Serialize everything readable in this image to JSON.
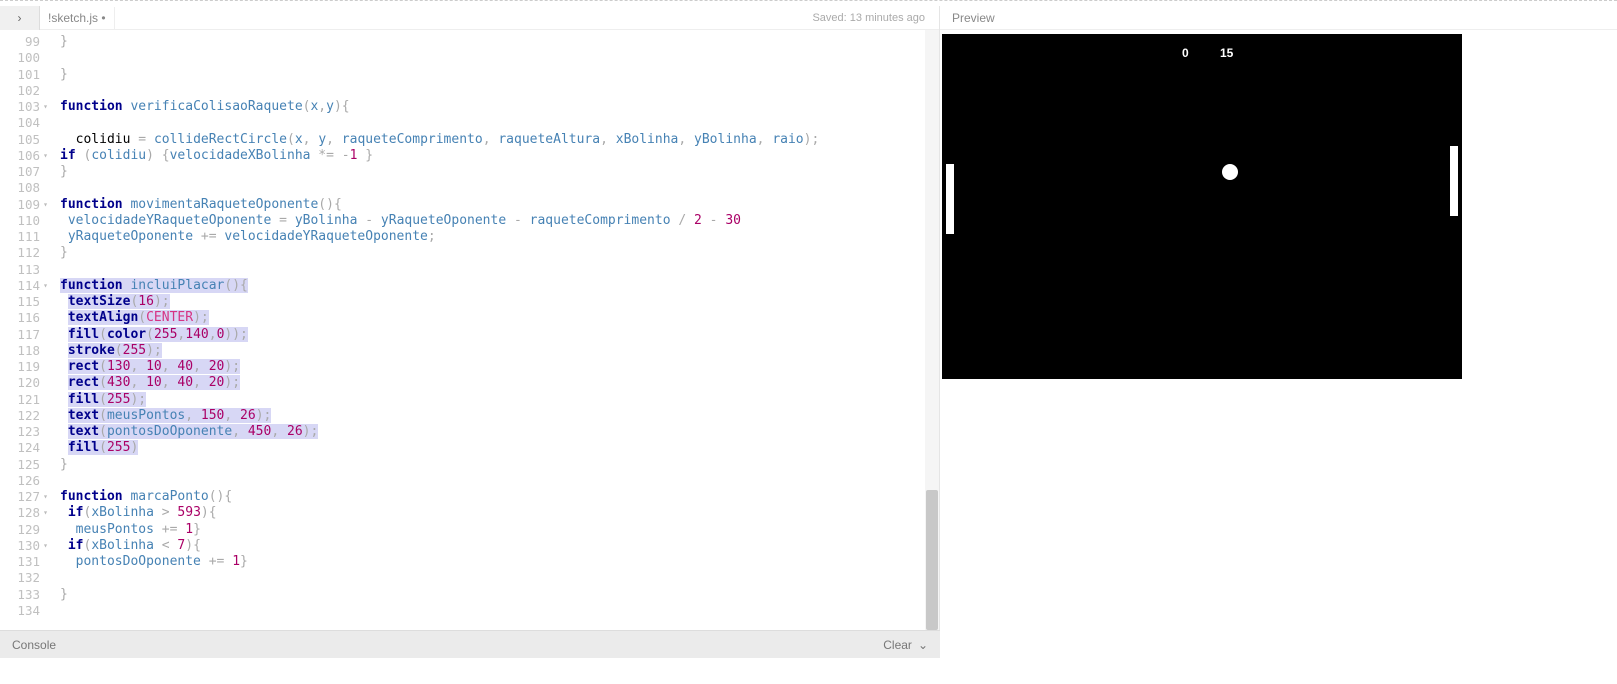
{
  "tab": {
    "toggle_icon": "›",
    "filename": "!sketch.js",
    "dirty": "•"
  },
  "saved": "Saved: 13 minutes ago",
  "preview_label": "Preview",
  "console": {
    "label": "Console",
    "clear": "Clear",
    "chevron": "⌄"
  },
  "lines": [
    {
      "n": 99,
      "h": [
        {
          "t": "}",
          "c": "pr"
        }
      ]
    },
    {
      "n": 100,
      "h": []
    },
    {
      "n": 101,
      "h": [
        {
          "t": "}",
          "c": "pr"
        }
      ]
    },
    {
      "n": 102,
      "h": []
    },
    {
      "n": 103,
      "fold": 1,
      "h": [
        {
          "t": "function ",
          "c": "kw"
        },
        {
          "t": "verificaColisaoRaquete",
          "c": "fn"
        },
        {
          "t": "(",
          "c": "pr"
        },
        {
          "t": "x",
          "c": "id"
        },
        {
          "t": ",",
          "c": "pr"
        },
        {
          "t": "y",
          "c": "id"
        },
        {
          "t": "){",
          "c": "pr"
        }
      ]
    },
    {
      "n": 104,
      "h": []
    },
    {
      "n": 105,
      "h": [
        {
          "t": "  colidiu ",
          "c": ""
        },
        {
          "t": "= ",
          "c": "pr"
        },
        {
          "t": "collideRectCircle",
          "c": "fn"
        },
        {
          "t": "(",
          "c": "pr"
        },
        {
          "t": "x",
          "c": "id"
        },
        {
          "t": ", ",
          "c": "pr"
        },
        {
          "t": "y",
          "c": "id"
        },
        {
          "t": ", ",
          "c": "pr"
        },
        {
          "t": "raqueteComprimento",
          "c": "id"
        },
        {
          "t": ", ",
          "c": "pr"
        },
        {
          "t": "raqueteAltura",
          "c": "id"
        },
        {
          "t": ", ",
          "c": "pr"
        },
        {
          "t": "xBolinha",
          "c": "id"
        },
        {
          "t": ", ",
          "c": "pr"
        },
        {
          "t": "yBolinha",
          "c": "id"
        },
        {
          "t": ", ",
          "c": "pr"
        },
        {
          "t": "raio",
          "c": "id"
        },
        {
          "t": ");",
          "c": "pr"
        }
      ]
    },
    {
      "n": 106,
      "fold": 1,
      "h": [
        {
          "t": "if ",
          "c": "kw"
        },
        {
          "t": "(",
          "c": "pr"
        },
        {
          "t": "colidiu",
          "c": "id"
        },
        {
          "t": ") {",
          "c": "pr"
        },
        {
          "t": "velocidadeXBolinha",
          "c": "id"
        },
        {
          "t": " *= -",
          "c": "pr"
        },
        {
          "t": "1",
          "c": "nm"
        },
        {
          "t": " }",
          "c": "pr"
        }
      ]
    },
    {
      "n": 107,
      "h": [
        {
          "t": "}",
          "c": "pr"
        }
      ]
    },
    {
      "n": 108,
      "h": []
    },
    {
      "n": 109,
      "fold": 1,
      "h": [
        {
          "t": "function ",
          "c": "kw"
        },
        {
          "t": "movimentaRaqueteOponente",
          "c": "fn"
        },
        {
          "t": "(){",
          "c": "pr"
        }
      ]
    },
    {
      "n": 110,
      "h": [
        {
          "t": " velocidadeYRaqueteOponente ",
          "c": "id"
        },
        {
          "t": "= ",
          "c": "pr"
        },
        {
          "t": "yBolinha",
          "c": "id"
        },
        {
          "t": " - ",
          "c": "pr"
        },
        {
          "t": "yRaqueteOponente",
          "c": "id"
        },
        {
          "t": " - ",
          "c": "pr"
        },
        {
          "t": "raqueteComprimento",
          "c": "id"
        },
        {
          "t": " / ",
          "c": "pr"
        },
        {
          "t": "2",
          "c": "nm"
        },
        {
          "t": " - ",
          "c": "pr"
        },
        {
          "t": "30",
          "c": "nm"
        }
      ]
    },
    {
      "n": 111,
      "h": [
        {
          "t": " yRaqueteOponente ",
          "c": "id"
        },
        {
          "t": "+= ",
          "c": "pr"
        },
        {
          "t": "velocidadeYRaqueteOponente",
          "c": "id"
        },
        {
          "t": ";",
          "c": "pr"
        }
      ]
    },
    {
      "n": 112,
      "h": [
        {
          "t": "}",
          "c": "pr"
        }
      ]
    },
    {
      "n": 113,
      "h": []
    },
    {
      "n": 114,
      "fold": 1,
      "h": [
        {
          "t": "function ",
          "c": "kw",
          "s": 1
        },
        {
          "t": "incluiPlacar",
          "c": "fn",
          "s": 1
        },
        {
          "t": "(){",
          "c": "pr",
          "s": 1
        }
      ]
    },
    {
      "n": 115,
      "h": [
        {
          "t": " ",
          "c": ""
        },
        {
          "t": "textSize",
          "c": "kw",
          "s": 1
        },
        {
          "t": "(",
          "c": "pr",
          "s": 1
        },
        {
          "t": "16",
          "c": "nm",
          "s": 1
        },
        {
          "t": ");",
          "c": "pr",
          "s": 1
        }
      ]
    },
    {
      "n": 116,
      "h": [
        {
          "t": " ",
          "c": ""
        },
        {
          "t": "textAlign",
          "c": "kw",
          "s": 1
        },
        {
          "t": "(",
          "c": "pr",
          "s": 1
        },
        {
          "t": "CENTER",
          "c": "ct",
          "s": 1
        },
        {
          "t": ");",
          "c": "pr",
          "s": 1
        }
      ]
    },
    {
      "n": 117,
      "h": [
        {
          "t": " ",
          "c": ""
        },
        {
          "t": "fill",
          "c": "kw",
          "s": 1
        },
        {
          "t": "(",
          "c": "pr",
          "s": 1
        },
        {
          "t": "color",
          "c": "kw",
          "s": 1
        },
        {
          "t": "(",
          "c": "pr",
          "s": 1
        },
        {
          "t": "255",
          "c": "nm",
          "s": 1
        },
        {
          "t": ",",
          "c": "pr",
          "s": 1
        },
        {
          "t": "140",
          "c": "nm",
          "s": 1
        },
        {
          "t": ",",
          "c": "pr",
          "s": 1
        },
        {
          "t": "0",
          "c": "nm",
          "s": 1
        },
        {
          "t": "));",
          "c": "pr",
          "s": 1
        }
      ]
    },
    {
      "n": 118,
      "h": [
        {
          "t": " ",
          "c": ""
        },
        {
          "t": "stroke",
          "c": "kw",
          "s": 1
        },
        {
          "t": "(",
          "c": "pr",
          "s": 1
        },
        {
          "t": "255",
          "c": "nm",
          "s": 1
        },
        {
          "t": ");",
          "c": "pr",
          "s": 1
        }
      ]
    },
    {
      "n": 119,
      "h": [
        {
          "t": " ",
          "c": ""
        },
        {
          "t": "rect",
          "c": "kw",
          "s": 1
        },
        {
          "t": "(",
          "c": "pr",
          "s": 1
        },
        {
          "t": "130",
          "c": "nm",
          "s": 1
        },
        {
          "t": ", ",
          "c": "pr",
          "s": 1
        },
        {
          "t": "10",
          "c": "nm",
          "s": 1
        },
        {
          "t": ", ",
          "c": "pr",
          "s": 1
        },
        {
          "t": "40",
          "c": "nm",
          "s": 1
        },
        {
          "t": ", ",
          "c": "pr",
          "s": 1
        },
        {
          "t": "20",
          "c": "nm",
          "s": 1
        },
        {
          "t": ");",
          "c": "pr",
          "s": 1
        }
      ]
    },
    {
      "n": 120,
      "h": [
        {
          "t": " ",
          "c": ""
        },
        {
          "t": "rect",
          "c": "kw",
          "s": 1
        },
        {
          "t": "(",
          "c": "pr",
          "s": 1
        },
        {
          "t": "430",
          "c": "nm",
          "s": 1
        },
        {
          "t": ", ",
          "c": "pr",
          "s": 1
        },
        {
          "t": "10",
          "c": "nm",
          "s": 1
        },
        {
          "t": ", ",
          "c": "pr",
          "s": 1
        },
        {
          "t": "40",
          "c": "nm",
          "s": 1
        },
        {
          "t": ", ",
          "c": "pr",
          "s": 1
        },
        {
          "t": "20",
          "c": "nm",
          "s": 1
        },
        {
          "t": ");",
          "c": "pr",
          "s": 1
        }
      ]
    },
    {
      "n": 121,
      "h": [
        {
          "t": " ",
          "c": ""
        },
        {
          "t": "fill",
          "c": "kw",
          "s": 1
        },
        {
          "t": "(",
          "c": "pr",
          "s": 1
        },
        {
          "t": "255",
          "c": "nm",
          "s": 1
        },
        {
          "t": ");",
          "c": "pr",
          "s": 1
        }
      ]
    },
    {
      "n": 122,
      "h": [
        {
          "t": " ",
          "c": ""
        },
        {
          "t": "text",
          "c": "kw",
          "s": 1
        },
        {
          "t": "(",
          "c": "pr",
          "s": 1
        },
        {
          "t": "meusPontos",
          "c": "id",
          "s": 1
        },
        {
          "t": ", ",
          "c": "pr",
          "s": 1
        },
        {
          "t": "150",
          "c": "nm",
          "s": 1
        },
        {
          "t": ", ",
          "c": "pr",
          "s": 1
        },
        {
          "t": "26",
          "c": "nm",
          "s": 1
        },
        {
          "t": ");",
          "c": "pr",
          "s": 1
        }
      ]
    },
    {
      "n": 123,
      "h": [
        {
          "t": " ",
          "c": ""
        },
        {
          "t": "text",
          "c": "kw",
          "s": 1
        },
        {
          "t": "(",
          "c": "pr",
          "s": 1
        },
        {
          "t": "pontosDoOponente",
          "c": "id",
          "s": 1
        },
        {
          "t": ", ",
          "c": "pr",
          "s": 1
        },
        {
          "t": "450",
          "c": "nm",
          "s": 1
        },
        {
          "t": ", ",
          "c": "pr",
          "s": 1
        },
        {
          "t": "26",
          "c": "nm",
          "s": 1
        },
        {
          "t": ");",
          "c": "pr",
          "s": 1
        }
      ]
    },
    {
      "n": 124,
      "h": [
        {
          "t": " ",
          "c": ""
        },
        {
          "t": "fill",
          "c": "kw",
          "s": 1
        },
        {
          "t": "(",
          "c": "pr",
          "s": 1
        },
        {
          "t": "255",
          "c": "nm",
          "s": 1
        },
        {
          "t": ")",
          "c": "pr",
          "s": 1
        }
      ]
    },
    {
      "n": 125,
      "h": [
        {
          "t": "}",
          "c": "pr"
        }
      ]
    },
    {
      "n": 126,
      "h": []
    },
    {
      "n": 127,
      "fold": 1,
      "h": [
        {
          "t": "function ",
          "c": "kw"
        },
        {
          "t": "marcaPonto",
          "c": "fn"
        },
        {
          "t": "(){",
          "c": "pr"
        }
      ]
    },
    {
      "n": 128,
      "fold": 1,
      "h": [
        {
          "t": " ",
          "c": ""
        },
        {
          "t": "if",
          "c": "kw"
        },
        {
          "t": "(",
          "c": "pr"
        },
        {
          "t": "xBolinha",
          "c": "id"
        },
        {
          "t": " > ",
          "c": "pr"
        },
        {
          "t": "593",
          "c": "nm"
        },
        {
          "t": "){",
          "c": "pr"
        }
      ]
    },
    {
      "n": 129,
      "h": [
        {
          "t": "  meusPontos ",
          "c": "id"
        },
        {
          "t": "+= ",
          "c": "pr"
        },
        {
          "t": "1",
          "c": "nm"
        },
        {
          "t": "}",
          "c": "pr"
        }
      ]
    },
    {
      "n": 130,
      "fold": 1,
      "h": [
        {
          "t": " ",
          "c": ""
        },
        {
          "t": "if",
          "c": "kw"
        },
        {
          "t": "(",
          "c": "pr"
        },
        {
          "t": "xBolinha",
          "c": "id"
        },
        {
          "t": " < ",
          "c": "pr"
        },
        {
          "t": "7",
          "c": "nm"
        },
        {
          "t": "){",
          "c": "pr"
        }
      ]
    },
    {
      "n": 131,
      "h": [
        {
          "t": "  pontosDoOponente ",
          "c": "id"
        },
        {
          "t": "+= ",
          "c": "pr"
        },
        {
          "t": "1",
          "c": "nm"
        },
        {
          "t": "}",
          "c": "pr"
        }
      ]
    },
    {
      "n": 132,
      "h": []
    },
    {
      "n": 133,
      "h": [
        {
          "t": "}",
          "c": "pr"
        }
      ]
    },
    {
      "n": 134,
      "h": []
    }
  ],
  "game": {
    "score_left": "0",
    "score_right": "15"
  }
}
